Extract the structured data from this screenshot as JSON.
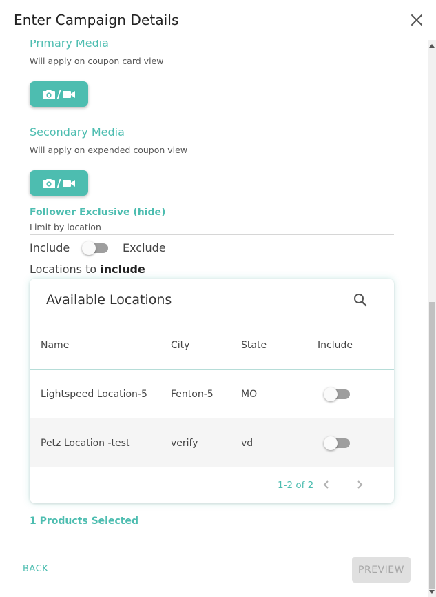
{
  "dialog": {
    "title": "Enter Campaign Details"
  },
  "primary_media": {
    "title": "Primary Media",
    "subtitle": "Will apply on coupon card view",
    "slash": "/"
  },
  "secondary_media": {
    "title": "Secondary Media",
    "subtitle": "Will apply on expended coupon view",
    "slash": "/"
  },
  "follower": {
    "title": "Follower Exclusive (hide)",
    "limit_label": "Limit by location"
  },
  "include_toggle": {
    "left_label": "Include",
    "right_label": "Exclude"
  },
  "locations_heading": {
    "prefix": "Locations to ",
    "emphasis": "include"
  },
  "table": {
    "title": "Available Locations",
    "columns": [
      "Name",
      "City",
      "State",
      "Include"
    ],
    "rows": [
      {
        "name": "Lightspeed Location-5",
        "city": "Fenton-5",
        "state": "MO"
      },
      {
        "name": "Petz Location -test",
        "city": "verify",
        "state": "vd"
      }
    ],
    "pagination": "1-2 of 2"
  },
  "products_selected": "1 Products Selected",
  "footer": {
    "back_label": "BACK",
    "preview_label": "PREVIEW"
  },
  "colors": {
    "accent": "#4dbdb0",
    "disabled_bg": "#e0e0e0",
    "disabled_text": "#a6a6a6"
  },
  "icons": {
    "close": "close-icon",
    "camera": "camera-icon",
    "video": "video-icon",
    "search": "search-icon",
    "prev": "chevron-left-icon",
    "next": "chevron-right-icon"
  }
}
